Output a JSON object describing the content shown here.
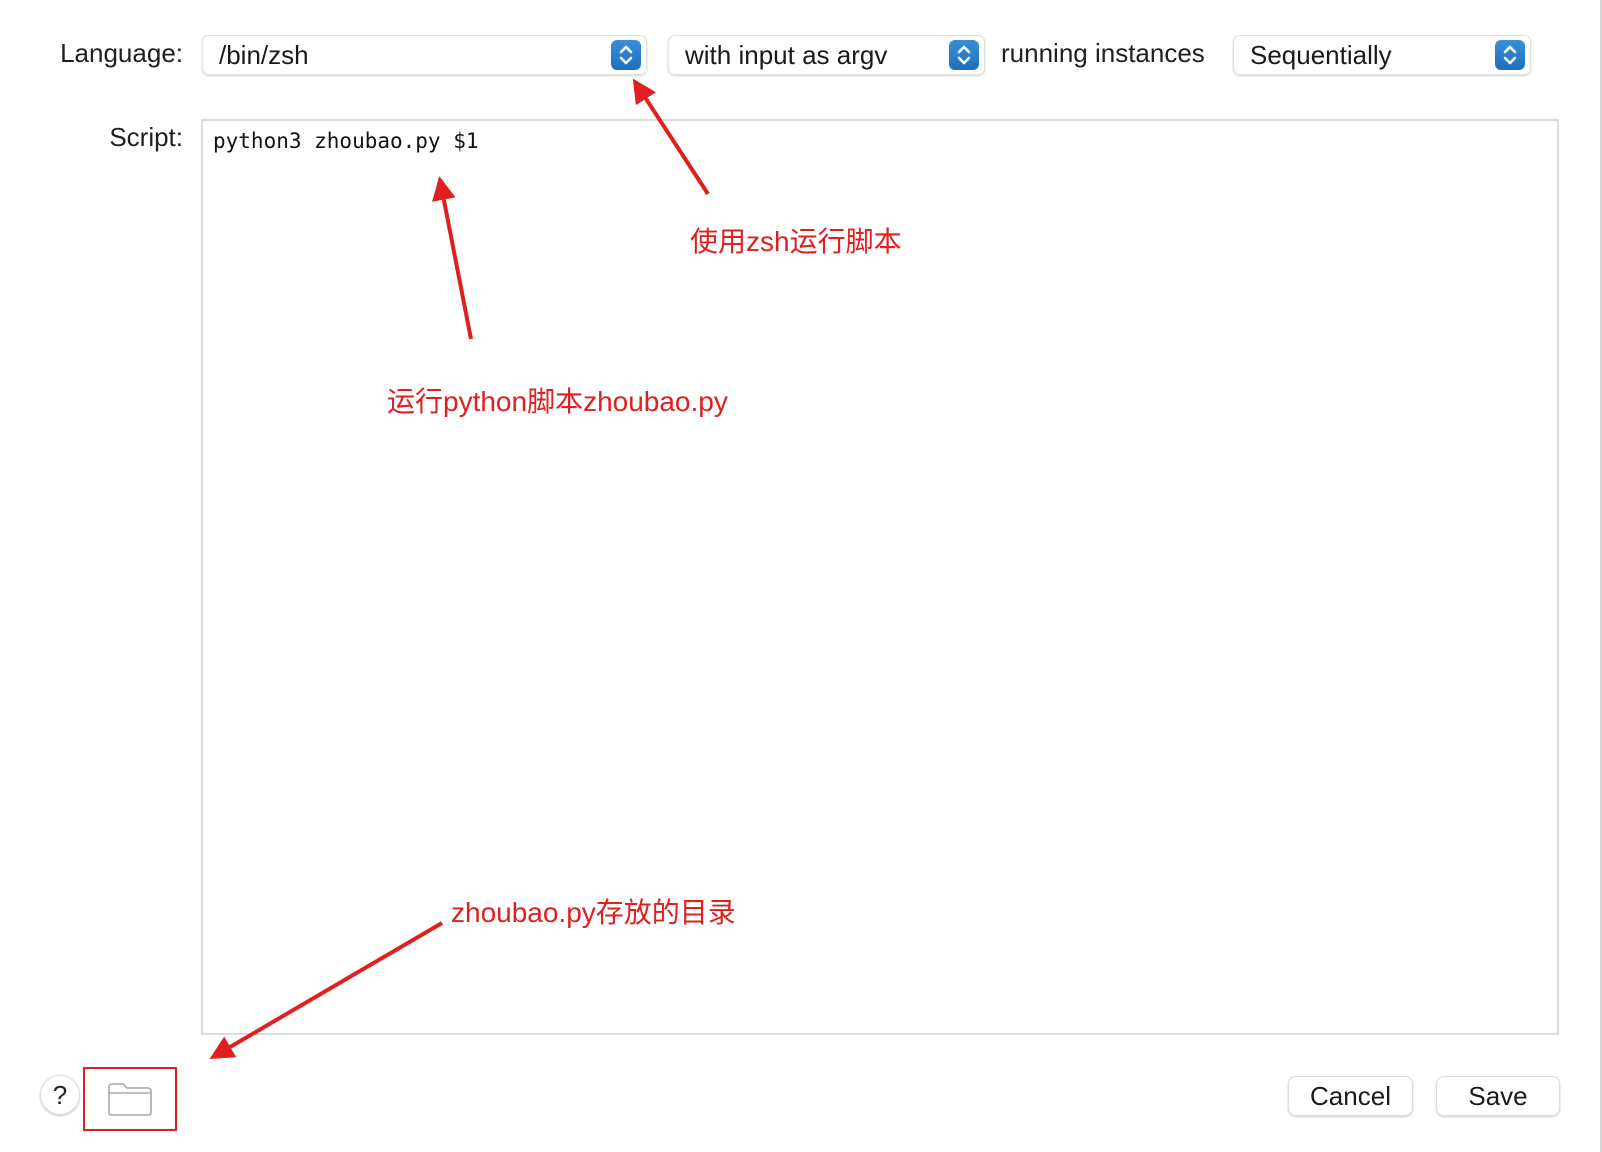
{
  "form": {
    "language_label": "Language:",
    "language_value": "/bin/zsh",
    "input_mode_value": "with input as argv",
    "running_label": "running instances",
    "running_value": "Sequentially",
    "script_label": "Script:",
    "script_text": "python3 zhoubao.py $1"
  },
  "annotations": {
    "zsh_note": "使用zsh运行脚本",
    "python_note": "运行python脚本zhoubao.py",
    "folder_note": "zhoubao.py存放的目录",
    "color": "#e02020"
  },
  "footer": {
    "help_label": "?",
    "cancel_label": "Cancel",
    "save_label": "Save"
  },
  "colors": {
    "stepper_accent": "#2a7fcf"
  },
  "icons": {
    "stepper": "chevron-up-down-icon",
    "folder": "folder-icon",
    "help": "question-icon"
  }
}
